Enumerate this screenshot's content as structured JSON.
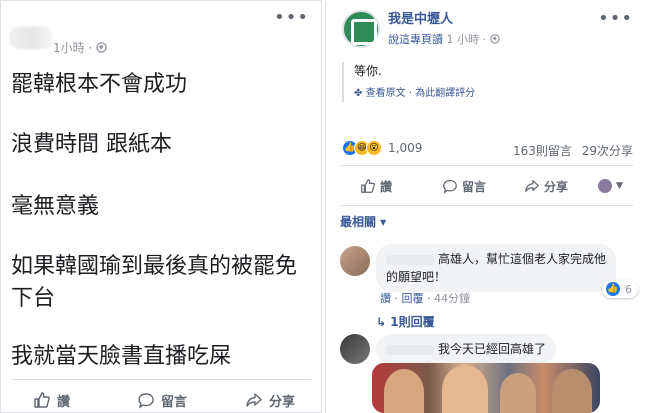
{
  "left_post": {
    "time": "1小時 ·",
    "paragraphs": [
      "罷韓根本不會成功",
      "浪費時間 跟紙本",
      "毫無意義",
      "如果韓國瑜到最後真的被罷免下台",
      "我就當天臉書直播吃屎"
    ],
    "actions": {
      "like": "讚",
      "comment": "留言",
      "share": "分享"
    }
  },
  "right_post": {
    "page_name": "我是中壢人",
    "edited_label": "說這專頁讀",
    "time": "1 小時 ·",
    "body": "等你.",
    "see_original": "查看原文",
    "rate_translation": "為此翻譯評分",
    "reaction_count": "1,009",
    "comment_count": "163則留言",
    "share_count": "29次分享",
    "actions": {
      "like": "讚",
      "comment": "留言",
      "share": "分享"
    },
    "sort_label": "最相關 ▾",
    "comments": [
      {
        "text": "高雄人，幫忙這個老人家完成他的願望吧！",
        "like": "讚",
        "reply": "回覆",
        "time": "44分鐘",
        "likes": "6",
        "replies_link": "1則回覆"
      },
      {
        "text": "我今天已經回高雄了"
      }
    ]
  }
}
